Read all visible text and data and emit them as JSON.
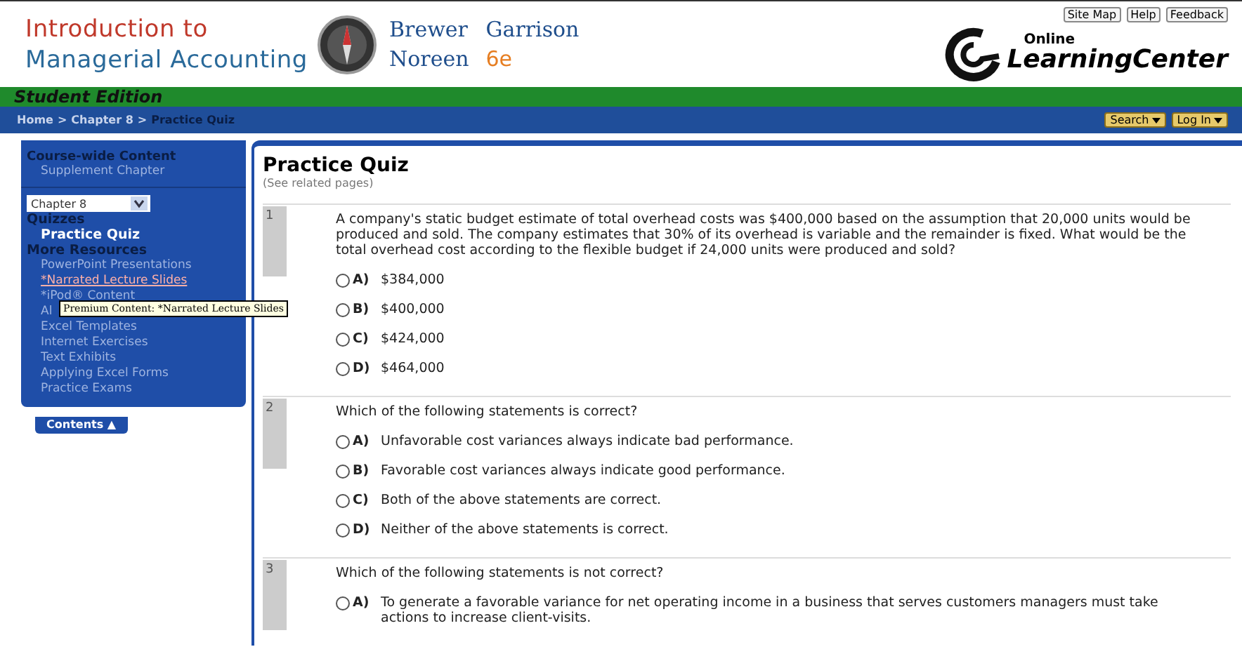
{
  "header": {
    "title_lines": [
      "Introduction to",
      "Managerial Accounting"
    ],
    "authors": [
      {
        "name": "Brewer",
        "kind": "author"
      },
      {
        "name": "Garrison",
        "kind": "author"
      },
      {
        "name": "Noreen",
        "kind": "author"
      },
      {
        "name": "6e",
        "kind": "edition"
      }
    ],
    "top_links": [
      "Site Map",
      "Help",
      "Feedback"
    ],
    "logo": {
      "small": "Online",
      "large": "LearningCenter"
    }
  },
  "edition_bar": "Student Edition",
  "breadcrumb": {
    "separator": ">",
    "items": [
      {
        "label": "Home",
        "current": false
      },
      {
        "label": "Chapter 8",
        "current": false
      },
      {
        "label": "Practice Quiz",
        "current": true
      }
    ],
    "buttons": [
      "Search",
      "Log In"
    ]
  },
  "sidebar": {
    "heading": "Course-wide Content",
    "link": "Supplement Chapter",
    "dropdown": "Chapter 8",
    "groups": [
      {
        "title": "Quizzes",
        "items": [
          {
            "label": "Practice Quiz",
            "selected": true,
            "hovered": false
          }
        ]
      },
      {
        "title": "More Resources",
        "items": [
          {
            "label": "PowerPoint Presentations",
            "selected": false,
            "hovered": false
          },
          {
            "label": "*Narrated Lecture Slides",
            "selected": false,
            "hovered": true
          },
          {
            "label": "*iPod® Content",
            "selected": false,
            "hovered": false
          },
          {
            "label": "Al",
            "selected": false,
            "hovered": false
          },
          {
            "label": "Excel Templates",
            "selected": false,
            "hovered": false
          },
          {
            "label": "Internet Exercises",
            "selected": false,
            "hovered": false
          },
          {
            "label": "Text Exhibits",
            "selected": false,
            "hovered": false
          },
          {
            "label": "Applying Excel Forms",
            "selected": false,
            "hovered": false
          },
          {
            "label": "Practice Exams",
            "selected": false,
            "hovered": false
          }
        ]
      }
    ],
    "tab": "Contents ▲",
    "tooltip": "Premium Content: *Narrated Lecture Slides"
  },
  "main": {
    "title": "Practice Quiz",
    "subtitle": "(See related pages)",
    "questions": [
      {
        "number": "1",
        "text": "A company's static budget estimate of total overhead costs was $400,000 based on the assumption that 20,000 units would be produced and sold. The company estimates that 30% of its overhead is variable and the remainder is fixed. What would be the total overhead cost according to the flexible budget if 24,000 units were produced and sold?",
        "options": [
          {
            "letter": "A)",
            "text": "$384,000",
            "selected": false
          },
          {
            "letter": "B)",
            "text": "$400,000",
            "selected": false
          },
          {
            "letter": "C)",
            "text": "$424,000",
            "selected": false
          },
          {
            "letter": "D)",
            "text": "$464,000",
            "selected": false
          }
        ]
      },
      {
        "number": "2",
        "text": "Which of the following statements is correct?",
        "options": [
          {
            "letter": "A)",
            "text": "Unfavorable cost variances always indicate bad performance.",
            "selected": false
          },
          {
            "letter": "B)",
            "text": "Favorable cost variances always indicate good performance.",
            "selected": false
          },
          {
            "letter": "C)",
            "text": "Both of the above statements are correct.",
            "selected": false
          },
          {
            "letter": "D)",
            "text": "Neither of the above statements is correct.",
            "selected": false
          }
        ]
      },
      {
        "number": "3",
        "text": "Which of the following statements is not correct?",
        "options": [
          {
            "letter": "A)",
            "text": "To generate a favorable variance for net operating income in a business that serves customers managers must take actions to increase client-visits.",
            "selected": false
          }
        ]
      }
    ]
  }
}
